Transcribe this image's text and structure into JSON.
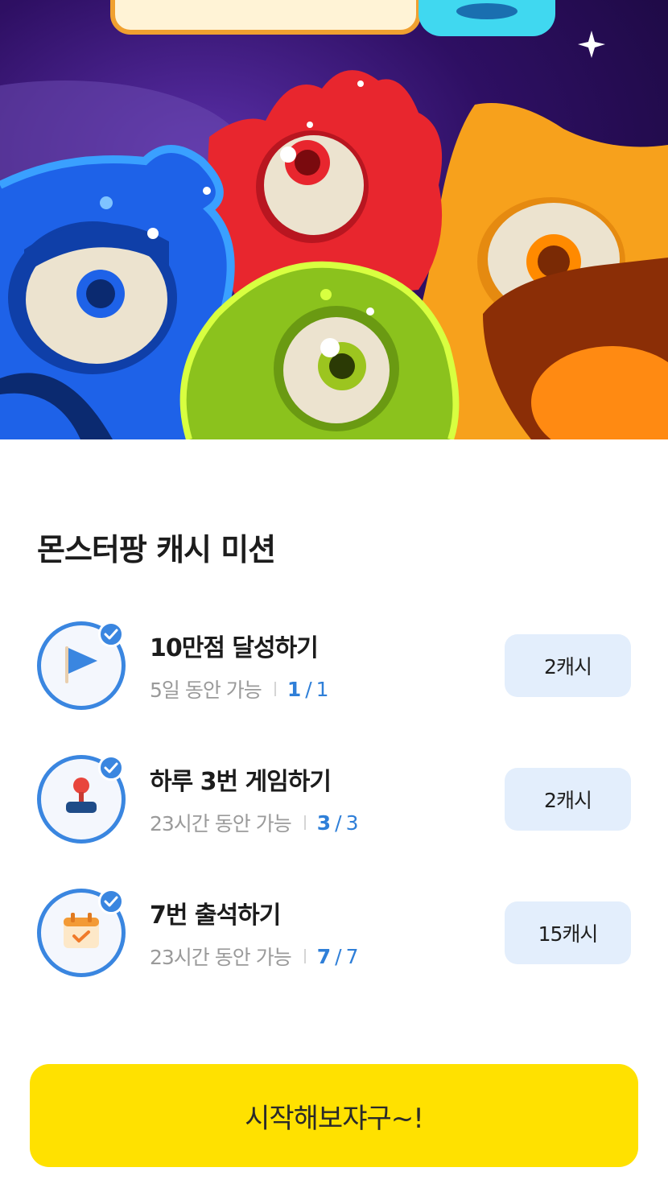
{
  "section_title": "몬스터팡 캐시 미션",
  "missions": [
    {
      "icon": "flag-icon",
      "title": "10만점 달성하기",
      "duration": "5일 동안 가능",
      "current": "1",
      "total": "1",
      "reward": "2캐시"
    },
    {
      "icon": "joystick-icon",
      "title": "하루 3번 게임하기",
      "duration": "23시간 동안 가능",
      "current": "3",
      "total": "3",
      "reward": "2캐시"
    },
    {
      "icon": "calendar-check-icon",
      "title": "7번 출석하기",
      "duration": "23시간 동안 가능",
      "current": "7",
      "total": "7",
      "reward": "15캐시"
    }
  ],
  "progress_separator": "/",
  "start_button": "시작해보쟈구~!",
  "colors": {
    "accent_blue": "#3a86e0",
    "reward_bg": "#e3eefc",
    "start_yellow": "#ffe100",
    "hero_bg": "#2a0d4f"
  }
}
